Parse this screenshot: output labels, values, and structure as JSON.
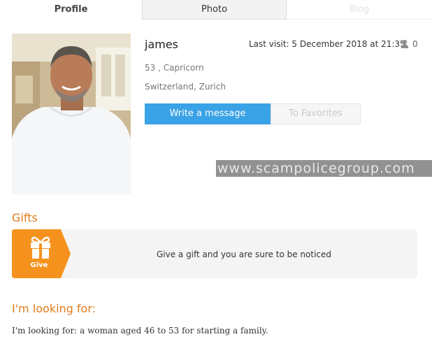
{
  "tabs": [
    {
      "label": "Profile"
    },
    {
      "label": "Photo"
    },
    {
      "label": "Blog"
    }
  ],
  "profile": {
    "name": "james",
    "last_visit": "Last visit: 5 December 2018 at 21:35",
    "visits_count": "0",
    "age_sign": "53 , Capricorn",
    "location": "Switzerland, Zurich",
    "write_message_label": "Write a message",
    "favorites_label": "To Favorites"
  },
  "watermark": "www.scampolicegroup.com",
  "gifts": {
    "title": "Gifts",
    "give_label": "Give",
    "description": "Give a gift and you are sure to be noticed"
  },
  "looking_for": {
    "title": "I'm looking for:",
    "text": "I'm looking for: a woman aged 46 to 53 for starting a family."
  },
  "colors": {
    "accent_blue": "#3aa2e6",
    "accent_orange": "#e07b1a",
    "gift_orange": "#f5921e"
  },
  "icons": {
    "visits": "person-icon",
    "gift": "gift-icon"
  }
}
